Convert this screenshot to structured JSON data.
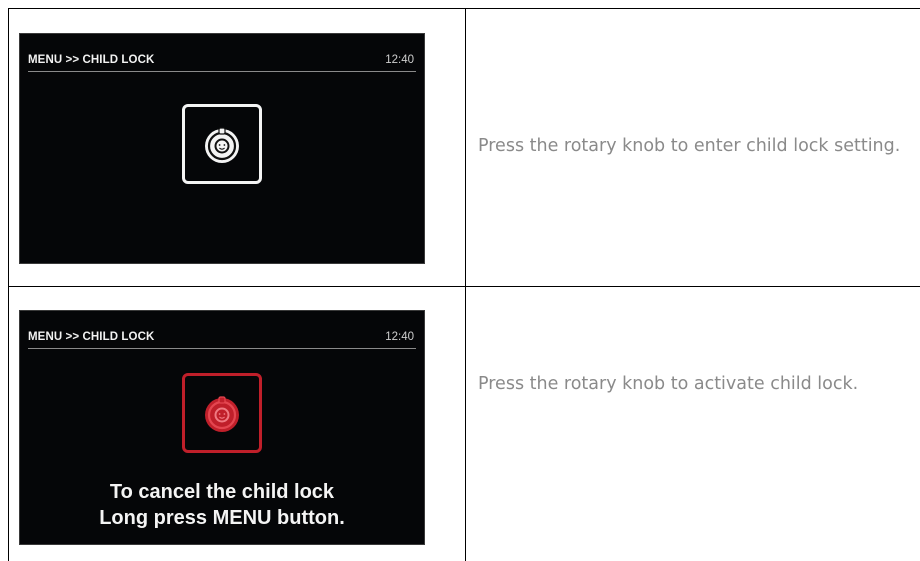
{
  "steps": [
    {
      "screen": {
        "menu_path": "MENU >> CHILD LOCK",
        "clock": "12:40",
        "icon": "child-lock-icon",
        "icon_state": "inactive",
        "icon_color": "#f4f4f4"
      },
      "description": "Press the rotary knob to enter child lock setting."
    },
    {
      "screen": {
        "menu_path": "MENU >> CHILD LOCK",
        "clock": "12:40",
        "icon": "child-lock-icon",
        "icon_state": "active",
        "icon_color": "#c01f2a",
        "message_line1": "To cancel the child lock",
        "message_line2": "Long press MENU button."
      },
      "description": "Press the rotary knob to activate child lock."
    }
  ]
}
